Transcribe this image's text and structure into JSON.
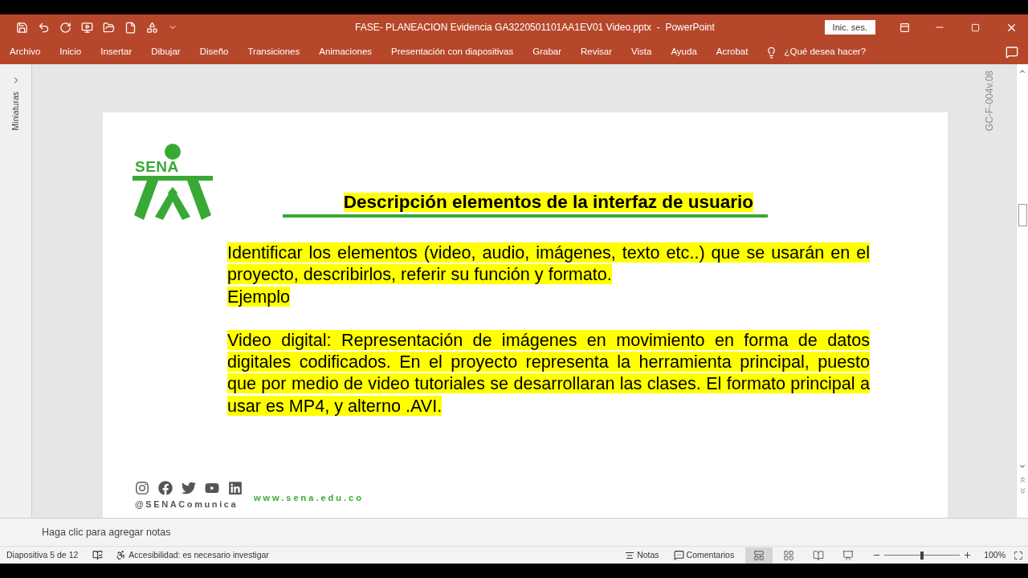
{
  "title_bar": {
    "title": "FASE- PLANEACION Evidencia GA3220501101AA1EV01 Video.pptx  -  PowerPoint",
    "sign_in": "Inic. ses."
  },
  "ribbon_tabs": [
    "Archivo",
    "Inicio",
    "Insertar",
    "Dibujar",
    "Diseño",
    "Transiciones",
    "Animaciones",
    "Presentación con diapositivas",
    "Grabar",
    "Revisar",
    "Vista",
    "Ayuda",
    "Acrobat"
  ],
  "tell_me": "¿Qué desea hacer?",
  "thumbnails_pane": {
    "label": "Miniaturas"
  },
  "side_code": "GC-F-004v.08",
  "slide": {
    "logo_text": "SENA",
    "heading": "Descripción elementos de la interfaz de usuario",
    "body_blocks": [
      [
        "Identificar los elementos (video, audio, imágenes, texto etc..) que se usarán en el proyecto, describirlos, referir su función y formato.",
        "Ejemplo"
      ],
      [
        "Video digital: Representación de imágenes en movimiento en forma de datos digitales codificados. En el proyecto representa la herramienta principal, puesto que por medio de video tutoriales se desarrollaran las clases. El formato principal a usar es MP4, y alterno .AVI."
      ]
    ],
    "footer": {
      "handle": "@SENAComunica",
      "website": "www.sena.edu.co"
    }
  },
  "notes": {
    "placeholder": "Haga clic para agregar notas"
  },
  "status_bar": {
    "slide_count": "Diapositiva 5 de 12",
    "accessibility": "Accesibilidad: es necesario investigar",
    "notes_button": "Notas",
    "comments_button": "Comentarios",
    "views": [
      {
        "kind": "normal",
        "selected": true
      },
      {
        "kind": "sorter",
        "selected": false
      },
      {
        "kind": "reading",
        "selected": false
      },
      {
        "kind": "presenter",
        "selected": false
      }
    ],
    "zoom": {
      "level": 0.5,
      "reading": "100%"
    }
  }
}
